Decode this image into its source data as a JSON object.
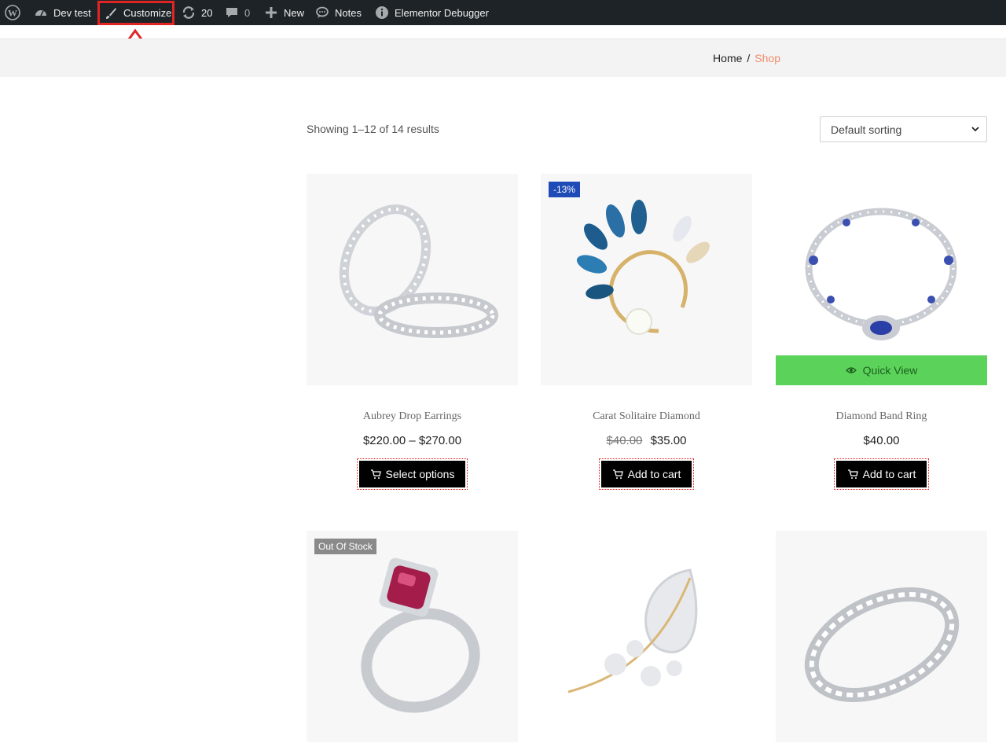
{
  "admin_bar": {
    "site_name": "Dev test",
    "customize": "Customize",
    "updates_count": "20",
    "comments_count": "0",
    "new_label": "New",
    "notes_label": "Notes",
    "debugger_label": "Elementor Debugger"
  },
  "breadcrumb": {
    "home": "Home",
    "separator": "/",
    "current": "Shop"
  },
  "shop": {
    "result_count": "Showing 1–12 of 14 results",
    "sort_selected": "Default sorting"
  },
  "products": [
    {
      "title": "Aubrey Drop Earrings",
      "price": "$220.00 – $270.00",
      "button": "Select options"
    },
    {
      "title": "Carat Solitaire Diamond",
      "price_old": "$40.00",
      "price": "$35.00",
      "button": "Add to cart",
      "badge": "-13%"
    },
    {
      "title": "Diamond Band Ring",
      "price": "$40.00",
      "button": "Add to cart",
      "quick_view": "Quick View"
    },
    {
      "badge": "Out Of Stock"
    },
    {},
    {}
  ],
  "colors": {
    "admin_bar_bg": "#1d2327",
    "highlight": "#e02525",
    "sale_badge": "#1e4bb7",
    "quick_view": "#5bd35b",
    "breadcrumb_current": "#f08a6c"
  }
}
